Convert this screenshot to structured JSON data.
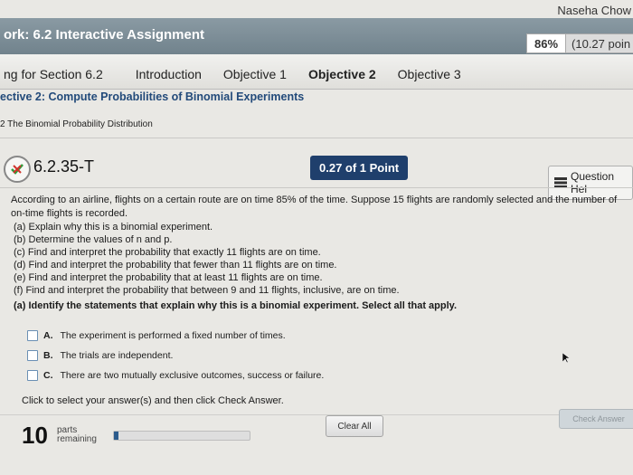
{
  "header": {
    "user_name": "Naseha Chow",
    "assignment_title": "ork: 6.2 Interactive Assignment",
    "score_percent": "86%",
    "score_points": "(10.27 poin"
  },
  "tabs": [
    {
      "label": "ng for Section 6.2",
      "active": false
    },
    {
      "label": "Introduction",
      "active": false
    },
    {
      "label": "Objective 1",
      "active": false
    },
    {
      "label": "Objective 2",
      "active": true
    },
    {
      "label": "Objective 3",
      "active": false
    }
  ],
  "section": {
    "title": "ective 2: Compute Probabilities of Binomial Experiments",
    "subtitle": "2 The Binomial Probability Distribution"
  },
  "question": {
    "id": "6.2.35-T",
    "points": "0.27 of 1 Point",
    "help_label": "Question Hel",
    "statement_line1": "According to an airline, flights on a certain route are on time 85% of the time. Suppose 15 flights are randomly selected and the number of",
    "statement_line2": "on-time flights is recorded.",
    "parts": [
      "(a) Explain why this is a binomial experiment.",
      "(b) Determine the values of n and p.",
      "(c) Find and interpret the probability that exactly 11 flights are on time.",
      "(d) Find and interpret the probability that fewer than 11 flights are on time.",
      "(e) Find and interpret the probability that at least 11 flights are on time.",
      "(f) Find and interpret the probability that between 9 and 11 flights, inclusive, are on time."
    ],
    "prompt": "(a) Identify the statements that explain why this is a binomial experiment. Select all that apply."
  },
  "options": [
    {
      "letter": "A.",
      "text": "The experiment is performed a fixed number of times."
    },
    {
      "letter": "B.",
      "text": "The trials are independent."
    },
    {
      "letter": "C.",
      "text": "There are two mutually exclusive outcomes, success or failure."
    }
  ],
  "footer": {
    "instruction": "Click to select your answer(s) and then click Check Answer.",
    "parts_count": "10",
    "parts_label_line1": "parts",
    "parts_label_line2": "remaining",
    "progress_fraction": 0.03,
    "clear_label": "Clear All",
    "check_label": "Check Answer"
  },
  "colors": {
    "accent": "#1f3f6c",
    "title_bar": "#7a8b94",
    "section_title": "#224a7a"
  }
}
